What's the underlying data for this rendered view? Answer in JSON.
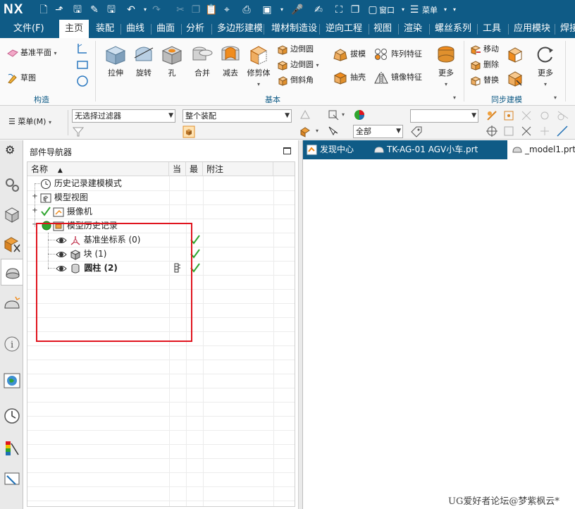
{
  "app": {
    "logo": "NX"
  },
  "quick_access": {
    "window_label": "窗口",
    "menu_label": "菜单"
  },
  "menu_tabs": [
    {
      "label": "文件(F)"
    },
    {
      "label": "主页"
    },
    {
      "label": "装配"
    },
    {
      "label": "曲线"
    },
    {
      "label": "曲面"
    },
    {
      "label": "分析"
    },
    {
      "label": "多边形建模"
    },
    {
      "label": "增材制造设"
    },
    {
      "label": "逆向工程"
    },
    {
      "label": "视图"
    },
    {
      "label": "渲染"
    },
    {
      "label": "螺丝系列"
    },
    {
      "label": "工具"
    },
    {
      "label": "应用模块"
    },
    {
      "label": "焊接"
    }
  ],
  "ribbon": {
    "construct": {
      "group_label": "构造",
      "datum_plane": "基准平面",
      "sketch": "草图"
    },
    "basic": {
      "group_label": "基本",
      "extrude": "拉伸",
      "revolve": "旋转",
      "hole": "孔",
      "unite": "合并",
      "subtract": "减去",
      "trim_body": "修剪体",
      "edge_blend": "边倒圆",
      "edge_blend2": "边倒圆",
      "chamfer": "倒斜角",
      "draft": "拔模",
      "pattern_feature": "阵列特征",
      "shell": "抽壳",
      "mirror_feature": "镜像特征",
      "more": "更多"
    },
    "sync": {
      "group_label": "同步建模",
      "move": "移动",
      "delete": "删除",
      "replace": "替换",
      "more": "更多"
    }
  },
  "toolbar2": {
    "menu_button": "菜单(M)",
    "filter": "无选择过滤器",
    "scope": "整个装配",
    "layer": "全部",
    "blank": ""
  },
  "navigator": {
    "title": "部件导航器",
    "columns": {
      "name": "名称",
      "current": "当",
      "latest": "最",
      "comment": "附注"
    },
    "nodes": [
      {
        "label": "历史记录建模模式"
      },
      {
        "label": "模型视图"
      },
      {
        "label": "摄像机"
      },
      {
        "label": "模型历史记录"
      },
      {
        "label": "基准坐标系 (0)"
      },
      {
        "label": "块 (1)"
      },
      {
        "label": "圆柱 (2)"
      }
    ]
  },
  "doc_tabs": [
    {
      "label": "发现中心"
    },
    {
      "label": "TK-AG-01 AGV小车.prt"
    },
    {
      "label": "_model1.prt"
    }
  ],
  "watermark": "UG爱好者论坛@梦紫枫云*",
  "colors": {
    "title_bar": "#0f5b86",
    "highlight_box": "#e0141e",
    "check": "#2fa52f",
    "accent": "#f08c1e"
  }
}
